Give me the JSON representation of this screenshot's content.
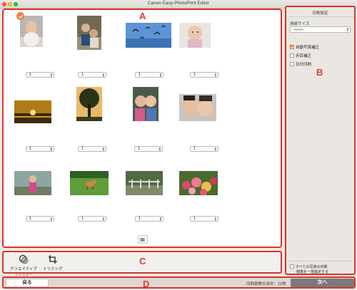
{
  "window": {
    "title": "Canon Easy-PhotoPrint Editor"
  },
  "labels": {
    "a": "A",
    "b": "B",
    "c": "C",
    "d": "D"
  },
  "photos": [
    {
      "qty": "1",
      "selected": true,
      "subject": "baby"
    },
    {
      "qty": "1",
      "selected": false,
      "subject": "children"
    },
    {
      "qty": "1",
      "selected": false,
      "subject": "birds-sky"
    },
    {
      "qty": "1",
      "selected": false,
      "subject": "baby-smiling"
    },
    {
      "qty": "1",
      "selected": false,
      "subject": "sunset"
    },
    {
      "qty": "1",
      "selected": false,
      "subject": "tree"
    },
    {
      "qty": "1",
      "selected": false,
      "subject": "kids-faces"
    },
    {
      "qty": "1",
      "selected": false,
      "subject": "kids-close"
    },
    {
      "qty": "1",
      "selected": false,
      "subject": "girl-outdoor"
    },
    {
      "qty": "1",
      "selected": false,
      "subject": "dog-grass"
    },
    {
      "qty": "1",
      "selected": false,
      "subject": "garden"
    },
    {
      "qty": "1",
      "selected": false,
      "subject": "flowers"
    }
  ],
  "tools": {
    "creative": "クリエイティブ",
    "creative_sub": "フィルター",
    "trim": "トリミング"
  },
  "panel": {
    "title": "印刷設定",
    "paper_size_label": "用紙サイズ",
    "auto_correct": {
      "label": "自動写真補正",
      "checked": true
    },
    "red_eye": {
      "label": "赤目補正",
      "checked": false
    },
    "date_print": {
      "label": "日付印刷",
      "checked": false
    },
    "bulk_line1": "すべての写真の印刷",
    "bulk_line2": "部数を一括指定する",
    "bulk_qty": "印刷： 1"
  },
  "footer": {
    "back": "戻る",
    "total": "印刷部数の合計：12枚",
    "next": "次へ"
  },
  "colors": {
    "accent": "#e8833a",
    "annotation": "#d9332a"
  }
}
